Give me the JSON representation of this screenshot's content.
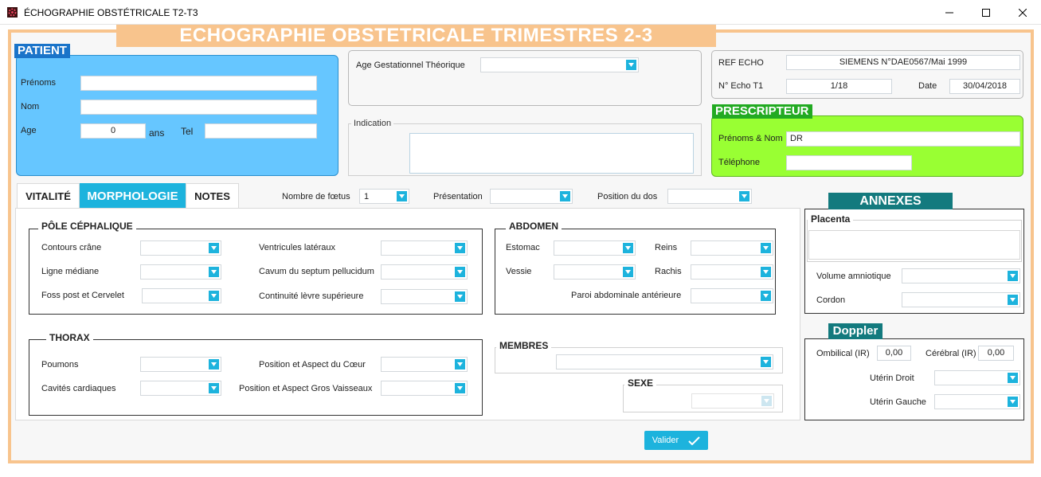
{
  "window": {
    "title": "ÉCHOGRAPHIE OBSTÉTRICALE T2-T3",
    "icon": "app-logo-icon",
    "controls": [
      "minimize-icon",
      "maximize-icon",
      "close-icon"
    ]
  },
  "banner": {
    "title": "ECHOGRAPHIE OBSTETRICALE TRIMESTRES 2-3"
  },
  "colors": {
    "accent": "#1db3dd",
    "frame": "#f8c48d",
    "patient": "#66c6ff",
    "patient_title": "#1a74c9",
    "prescripteur": "#99ff33",
    "prescripteur_title": "#22aa22",
    "annexes": "#137a7e"
  },
  "patient": {
    "title": "PATIENT",
    "prenoms_label": "Prénoms",
    "prenoms_value": "",
    "nom_label": "Nom",
    "nom_value": "",
    "age_label": "Age",
    "age_value": "0",
    "age_unit": "ans",
    "tel_label": "Tel",
    "tel_value": ""
  },
  "gestation": {
    "label": "Age Gestationnel Théorique",
    "value": ""
  },
  "indication": {
    "label": "Indication",
    "value": ""
  },
  "ref": {
    "ref_echo_label": "REF ECHO",
    "ref_echo_value": "SIEMENS N°DAE0567/Mai 1999",
    "no_echo_label": "N° Echo T1",
    "no_echo_value": "1/18",
    "date_label": "Date",
    "date_value": "30/04/2018"
  },
  "prescripteur": {
    "title": "PRESCRIPTEUR",
    "nom_label": "Prénoms & Nom",
    "nom_value": "DR",
    "tel_label": "Téléphone",
    "tel_value": ""
  },
  "tabs": [
    {
      "label": "VITALITÉ",
      "active": false
    },
    {
      "label": "MORPHOLOGIE",
      "active": true
    },
    {
      "label": "NOTES",
      "active": false
    }
  ],
  "toolbar": {
    "nb_foetus_label": "Nombre de fœtus",
    "nb_foetus_value": "1",
    "presentation_label": "Présentation",
    "presentation_value": "",
    "dos_label": "Position du dos",
    "dos_value": ""
  },
  "pole": {
    "title": "PÔLE CÉPHALIQUE",
    "contours_label": "Contours crâne",
    "ligne_label": "Ligne médiane",
    "foss_label": "Foss post et Cervelet",
    "ventricules_label": "Ventricules latéraux",
    "cavum_label": "Cavum du septum pellucidum",
    "levre_label": "Continuité lèvre supérieure"
  },
  "abdomen": {
    "title": "ABDOMEN",
    "estomac_label": "Estomac",
    "vessie_label": "Vessie",
    "reins_label": "Reins",
    "rachis_label": "Rachis",
    "paroi_label": "Paroi abdominale antérieure"
  },
  "thorax": {
    "title": "THORAX",
    "poumons_label": "Poumons",
    "cavites_label": "Cavités cardiaques",
    "coeur_label": "Position et Aspect du Cœur",
    "vaisseaux_label": "Position et Aspect Gros Vaisseaux"
  },
  "membres": {
    "title": "MEMBRES"
  },
  "sexe": {
    "title": "SEXE"
  },
  "annexes": {
    "title": "ANNEXES",
    "placenta_label": "Placenta",
    "volume_label": "Volume amniotique",
    "cordon_label": "Cordon"
  },
  "doppler": {
    "title": "Doppler",
    "ombilical_label": "Ombilical (IR)",
    "ombilical_value": "0,00",
    "cerebral_label": "Cérébral (IR)",
    "cerebral_value": "0,00",
    "uterin_droit_label": "Utérin Droit",
    "uterin_gauche_label": "Utérin Gauche"
  },
  "validate": {
    "label": "Valider",
    "icon": "checkmark-icon"
  }
}
